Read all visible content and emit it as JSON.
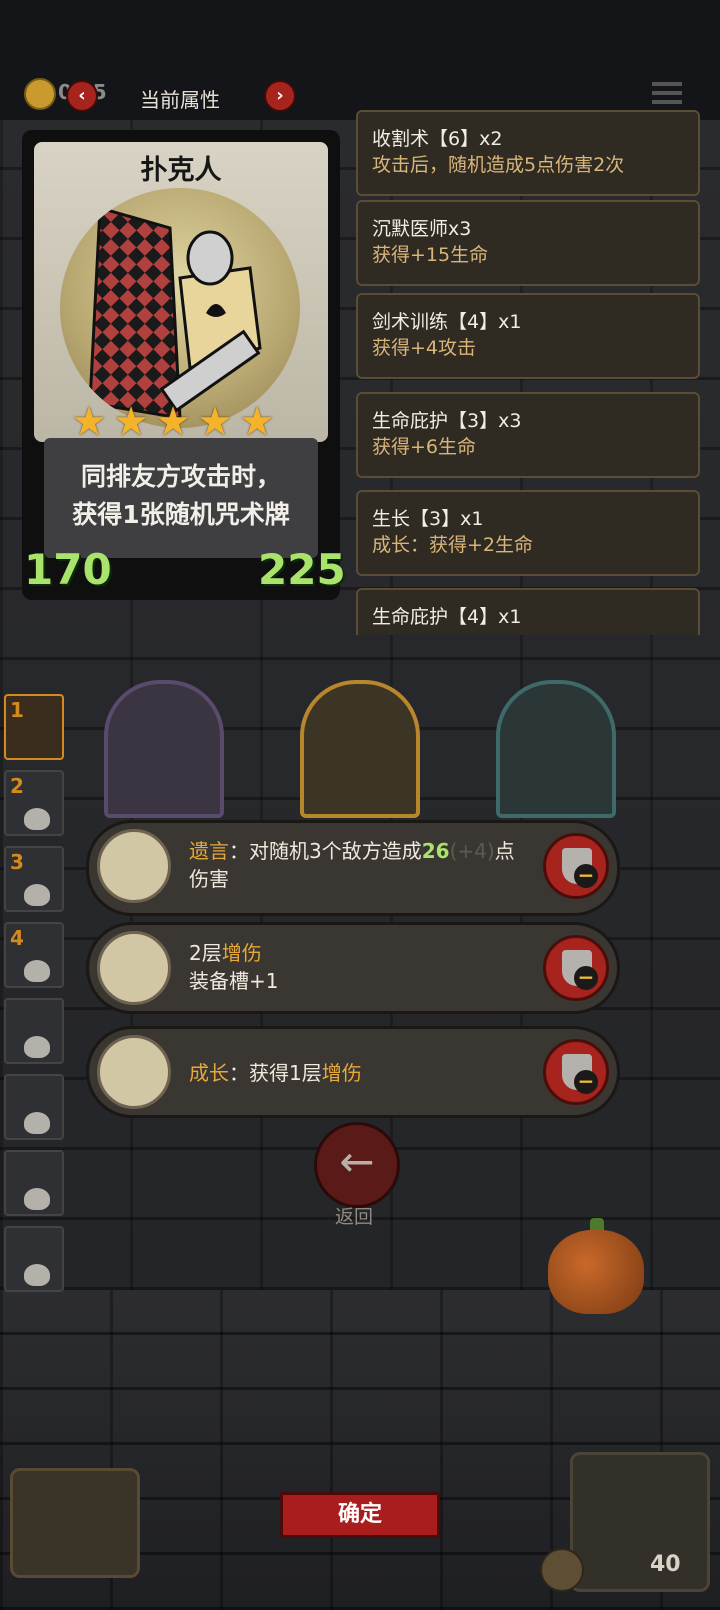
{
  "header": {
    "coin_value": "0 15",
    "tab_title": "当前属性",
    "prev_icon": "chevron-left-icon",
    "next_icon": "chevron-right-icon"
  },
  "card": {
    "name": "扑克人",
    "stars": 5,
    "description_line1": "同排友方攻击时，",
    "description_line2": "获得1张随机咒术牌",
    "attack": "170",
    "health": "225"
  },
  "attributes": [
    {
      "name": "收割术【6】x2",
      "desc": "攻击后，随机造成5点伤害2次"
    },
    {
      "name": "沉默医师x3",
      "desc": "获得+15生命"
    },
    {
      "name": "剑术训练【4】x1",
      "desc": "获得+4攻击"
    },
    {
      "name": "生命庇护【3】x3",
      "desc": "获得+6生命"
    },
    {
      "name": "生长【3】x1",
      "desc": "成长：获得+2生命"
    },
    {
      "name": "生命庇护【4】x1",
      "desc": ""
    }
  ],
  "lineup_slots": [
    "1",
    "2",
    "3",
    "4",
    "",
    "",
    "",
    ""
  ],
  "effects": [
    {
      "keyword": "遗言",
      "text_a": "：对随机3个敌方造成",
      "value": "26",
      "dim": "(+4)",
      "text_b": "点伤害"
    },
    {
      "line1_prefix": "2层",
      "keyword": "增伤",
      "line2": "装备槽+1"
    },
    {
      "keyword": "成长",
      "text_a": "：获得1层",
      "keyword2": "增伤"
    }
  ],
  "back_label": "返回",
  "confirm_label": "确定",
  "hud": {
    "heart_value": "40"
  },
  "colors": {
    "accent_red": "#a91d1d",
    "highlight_yellow": "#e8a93a",
    "stat_green": "#a9e36b"
  }
}
